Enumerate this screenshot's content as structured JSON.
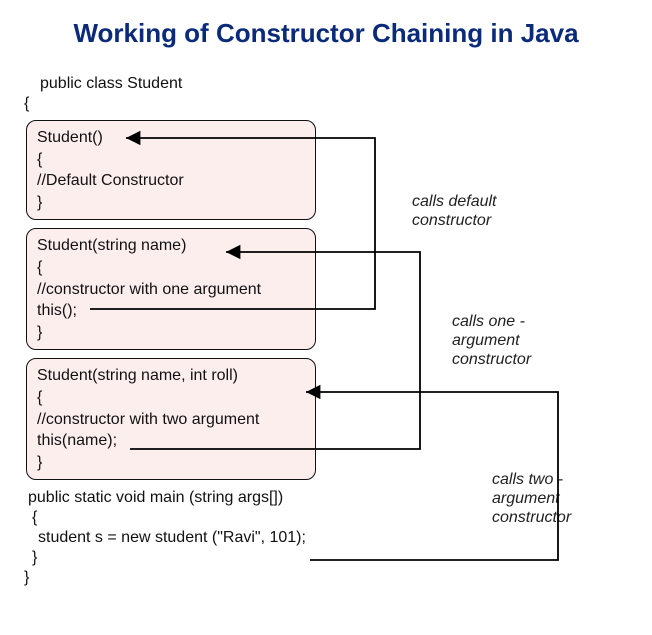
{
  "title": "Working of Constructor Chaining in Java",
  "classDecl": "public class Student",
  "openBrace": "{",
  "closeBrace": "}",
  "box1": {
    "sig": "Student()",
    "open": "{",
    "comment": "//Default Constructor",
    "close": "}"
  },
  "box2": {
    "sig": "Student(string name)",
    "open": "{",
    "comment": "//constructor with one argument",
    "call": "this();",
    "close": "}"
  },
  "box3": {
    "sig": "Student(string name, int roll)",
    "open": "{",
    "comment": "//constructor with two argument",
    "call": "this(name);",
    "close": "}"
  },
  "mainSig": "public static void main (string args[])",
  "mainOpen": "{",
  "mainCall": "student s = new student (\"Ravi\", 101);",
  "mainClose": "}",
  "label1a": "calls default",
  "label1b": "constructor",
  "label2a": "calls one -",
  "label2b": "argument",
  "label2c": "constructor",
  "label3a": "calls two -",
  "label3b": "argument",
  "label3c": "constructor"
}
